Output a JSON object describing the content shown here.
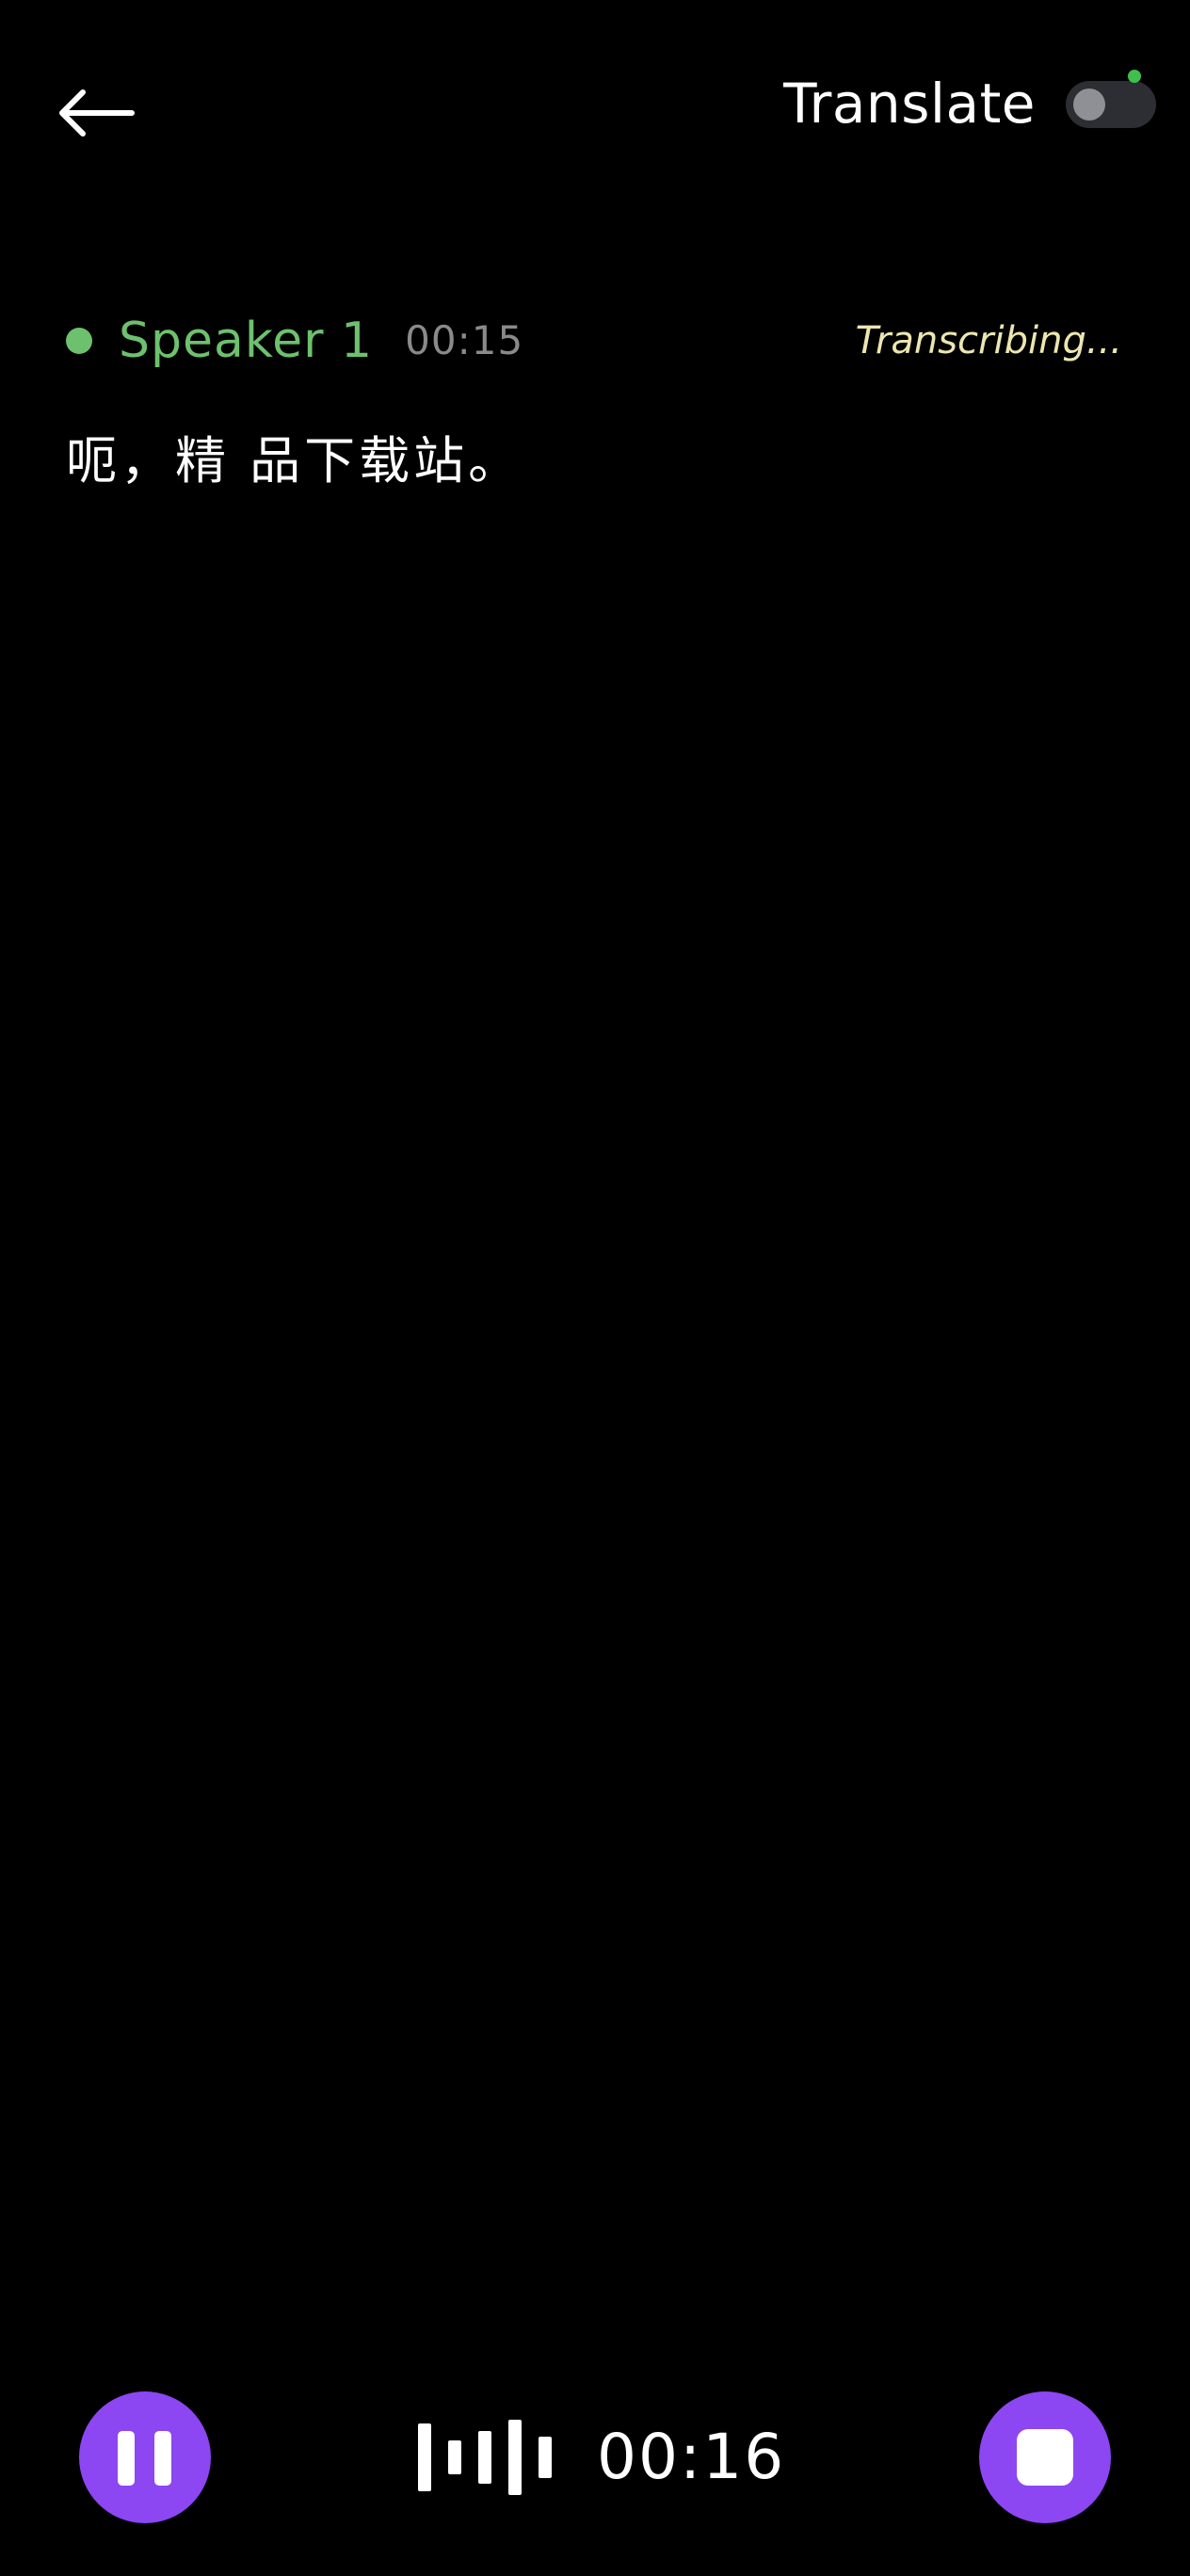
{
  "header": {
    "back_icon": "arrow-left-icon",
    "translate_label": "Translate",
    "translate_enabled": false
  },
  "speaker": {
    "name": "Speaker 1",
    "timestamp": "00:15",
    "status": "Transcribing..."
  },
  "transcript": {
    "text": "呃，精 品下载站。"
  },
  "controls": {
    "pause_icon": "pause-icon",
    "stop_icon": "stop-icon",
    "waveform_icon": "waveform-icon",
    "elapsed_time": "00:16"
  },
  "colors": {
    "background": "#000000",
    "accent": "#8c46f2",
    "speaker": "#6dc16e",
    "status": "#ece6b0",
    "toggle_track": "#2c2e33",
    "toggle_indicator": "#3fbf4e",
    "muted_text": "#8a8a8a"
  }
}
